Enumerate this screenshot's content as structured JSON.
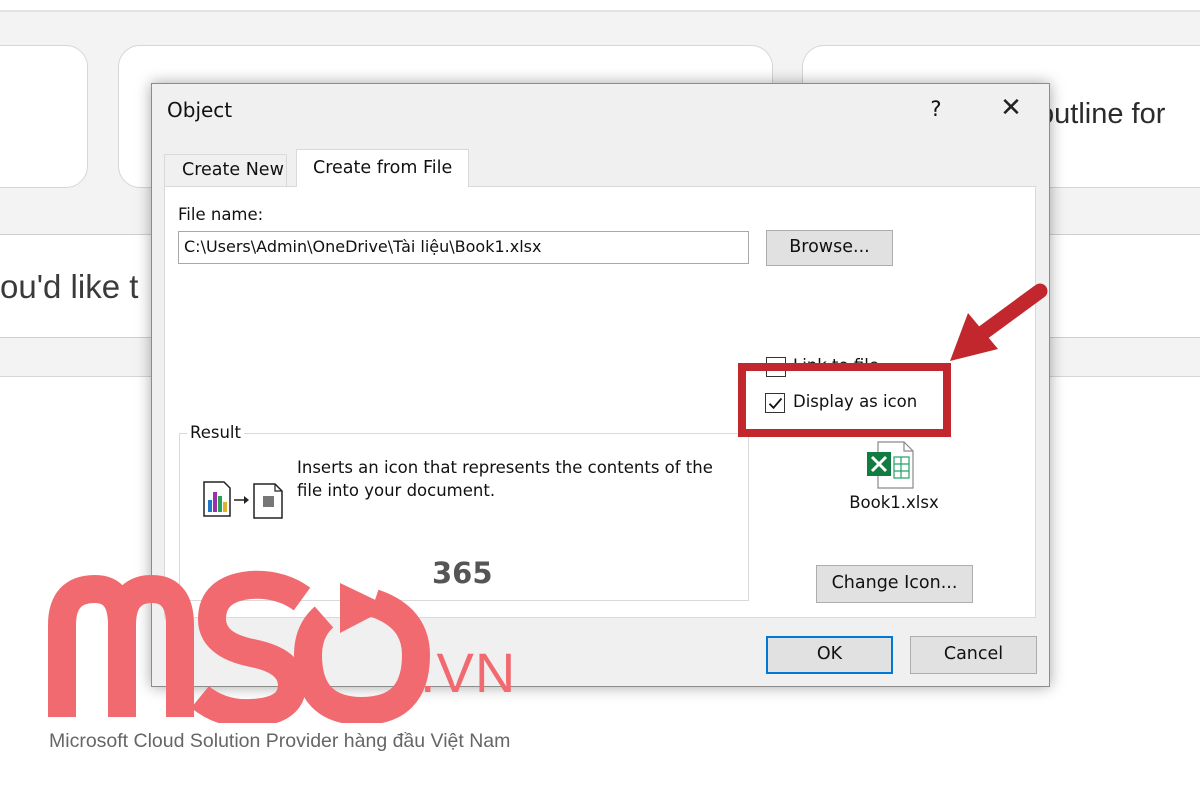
{
  "background": {
    "card_text": "outline for",
    "input_text": "ou'd like t"
  },
  "dialog": {
    "title": "Object",
    "help_label": "?",
    "close_label": "✕",
    "tabs": [
      {
        "label": "Create New",
        "active": false
      },
      {
        "label": "Create from File",
        "active": true
      }
    ],
    "file_name_label": "File name:",
    "file_name_value": "C:\\Users\\Admin\\OneDrive\\Tài liệu\\Book1.xlsx",
    "browse_label": "Browse...",
    "link_to_file_label": "Link to file",
    "link_to_file_checked": false,
    "display_as_icon_label": "Display as icon",
    "display_as_icon_checked": true,
    "result_label": "Result",
    "result_text": "Inserts an icon that represents the contents of the file into your document.",
    "icon_caption": "Book1.xlsx",
    "change_icon_label": "Change Icon...",
    "ok_label": "OK",
    "cancel_label": "Cancel"
  },
  "annotation": {
    "color": "#c1272d"
  },
  "watermark": {
    "brand_number": "365",
    "domain": ".VN",
    "tagline": "Microsoft Cloud Solution Provider hàng đầu Việt Nam",
    "color": "#f06a6f"
  }
}
